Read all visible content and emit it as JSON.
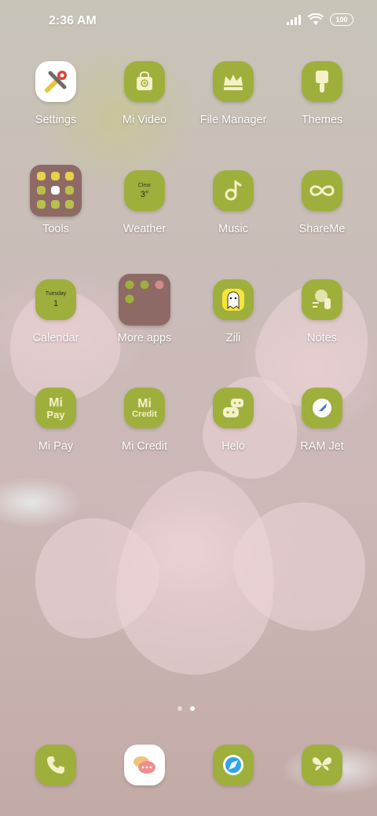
{
  "status_bar": {
    "time": "2:36 AM",
    "battery": "100"
  },
  "apps": [
    {
      "label": "Settings"
    },
    {
      "label": "Mi Video"
    },
    {
      "label": "File Manager"
    },
    {
      "label": "Themes"
    },
    {
      "label": "Tools"
    },
    {
      "label": "Weather",
      "weather_text": "Clear",
      "weather_temp": "3°"
    },
    {
      "label": "Music"
    },
    {
      "label": "ShareMe"
    },
    {
      "label": "Calendar",
      "day_name": "Tuesday",
      "day_num": "1"
    },
    {
      "label": "More apps"
    },
    {
      "label": "Zili"
    },
    {
      "label": "Notes"
    },
    {
      "label": "Mi Pay",
      "icon_top": "Mi",
      "icon_bottom": "Pay"
    },
    {
      "label": "Mi Credit",
      "icon_top": "Mi",
      "icon_bottom": "Credit"
    },
    {
      "label": "Helo"
    },
    {
      "label": "RAM Jet"
    }
  ],
  "page_indicator": {
    "pages": 2,
    "current": 2
  },
  "dock": [
    {
      "name": "Phone"
    },
    {
      "name": "Messaging"
    },
    {
      "name": "Browser"
    },
    {
      "name": "Gallery"
    }
  ],
  "colors": {
    "icon_green": "#9faf3c",
    "folder_brown": "#8e6a66",
    "icon_cream": "#f4f0c8"
  }
}
